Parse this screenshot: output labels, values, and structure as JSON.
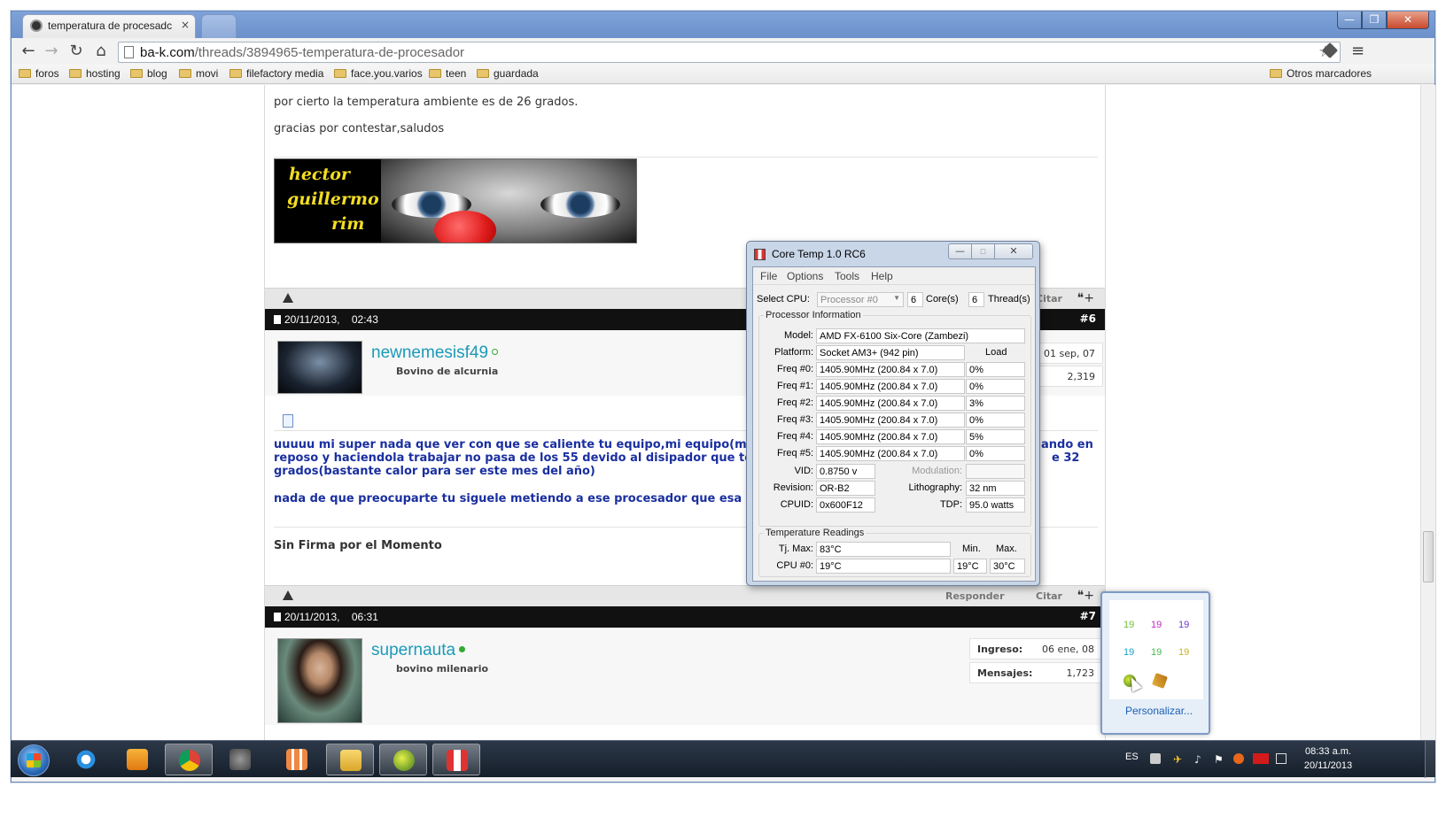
{
  "browser": {
    "tab_title": "temperatura de procesadc",
    "tab_close": "×",
    "url_host": "ba-k.com",
    "url_path": "/threads/3894965-temperatura-de-procesador",
    "win_min": "—",
    "win_max": "❐",
    "win_close": "✕",
    "bookmarks": [
      "foros",
      "hosting",
      "blog",
      "movi",
      "filefactory media",
      "face.you.varios",
      "teen",
      "guardada"
    ],
    "other_bookmarks": "Otros marcadores"
  },
  "page": {
    "intro_line1": "por cierto la temperatura ambiente es de 26 grados.",
    "intro_line2": "gracias por contestar,saludos",
    "sig_words": [
      "hector",
      "guillermo",
      "rim"
    ],
    "tools_reply": "Responder",
    "tools_quote": "Citar",
    "posts": [
      {
        "date": "20/11/2013,",
        "time": "02:43",
        "number": "#6",
        "username": "newnemesisf49",
        "user_title": "Bovino de alcurnia",
        "info_values": [
          "01 sep, 07",
          "2,319"
        ],
        "body_line1": "uuuuu mi super nada que ver con que se caliente tu equipo,mi equipo(mismo",
        "body_line1_tail": "ando en",
        "body_line2": "reposo y haciendola trabajar no pasa de los 55 devido al disipador que tengo",
        "body_line2_tail": "e 32",
        "body_line3": "grados(bastante calor para ser este mes del año)",
        "body_line4": "nada de que preocuparte tu siguele metiendo a ese procesador que esa temp",
        "signature": "Sin Firma por el Momento"
      },
      {
        "date": "20/11/2013,",
        "time": "06:31",
        "number": "#7",
        "username": "supernauta",
        "user_title": "bovino milenario",
        "info_rows": [
          {
            "label": "Ingreso:",
            "value": "06 ene, 08"
          },
          {
            "label": "Mensajes:",
            "value": "1,723"
          }
        ]
      }
    ]
  },
  "coretemp": {
    "title": "Core Temp 1.0 RC6",
    "menu": [
      "File",
      "Options",
      "Tools",
      "Help"
    ],
    "select_cpu_label": "Select CPU:",
    "select_cpu_value": "Processor #0",
    "cores": "6",
    "cores_label": "Core(s)",
    "threads": "6",
    "threads_label": "Thread(s)",
    "proc_info_title": "Processor Information",
    "model_label": "Model:",
    "model": "AMD FX-6100 Six-Core (Zambezi)",
    "platform_label": "Platform:",
    "platform": "Socket AM3+ (942 pin)",
    "load_label": "Load",
    "freqs": [
      {
        "label": "Freq #0:",
        "value": "1405.90MHz (200.84 x 7.0)",
        "load": "0%"
      },
      {
        "label": "Freq #1:",
        "value": "1405.90MHz (200.84 x 7.0)",
        "load": "0%"
      },
      {
        "label": "Freq #2:",
        "value": "1405.90MHz (200.84 x 7.0)",
        "load": "3%"
      },
      {
        "label": "Freq #3:",
        "value": "1405.90MHz (200.84 x 7.0)",
        "load": "0%"
      },
      {
        "label": "Freq #4:",
        "value": "1405.90MHz (200.84 x 7.0)",
        "load": "5%"
      },
      {
        "label": "Freq #5:",
        "value": "1405.90MHz (200.84 x 7.0)",
        "load": "0%"
      }
    ],
    "vid_label": "VID:",
    "vid": "0.8750 v",
    "modulation_label": "Modulation:",
    "revision_label": "Revision:",
    "revision": "OR-B2",
    "lithography_label": "Lithography:",
    "lithography": "32 nm",
    "cpuid_label": "CPUID:",
    "cpuid": "0x600F12",
    "tdp_label": "TDP:",
    "tdp": "95.0 watts",
    "temp_title": "Temperature Readings",
    "tjmax_label": "Tj. Max:",
    "tjmax": "83°C",
    "min_label": "Min.",
    "max_label": "Max.",
    "cpu0_label": "CPU #0:",
    "cpu0": "19°C",
    "cpu0_min": "19°C",
    "cpu0_max": "30°C"
  },
  "tray_popup": {
    "temps": [
      "19",
      "19",
      "19",
      "19",
      "19",
      "19"
    ],
    "temp_colors": [
      "#6fbf3a",
      "#c02ac0",
      "#6a3ad0",
      "#1aa3c8",
      "#47b84a",
      "#c7b422"
    ],
    "customize": "Personalizar..."
  },
  "taskbar": {
    "lang": "ES",
    "time": "08:33 a.m.",
    "date": "20/11/2013"
  }
}
